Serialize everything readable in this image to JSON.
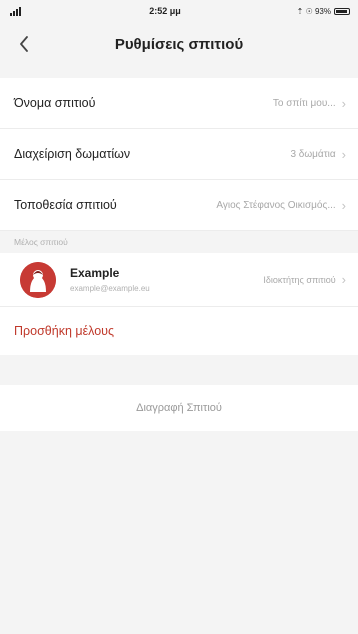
{
  "status_bar": {
    "time": "2:52 μμ",
    "battery_text": "⇡ ☉ 93%"
  },
  "nav": {
    "title": "Ρυθμίσεις σπιτιού",
    "back_icon": "chevron-left-icon"
  },
  "settings": [
    {
      "label": "Όνομα σπιτιού",
      "value": "Το σπίτι μου..."
    },
    {
      "label": "Διαχείριση δωματίων",
      "value": "3 δωμάτια"
    },
    {
      "label": "Τοποθεσία σπιτιού",
      "value": "Αγιος Στέφανος Οικισμός..."
    }
  ],
  "members_section": {
    "header": "Μέλος σπιτιού",
    "members": [
      {
        "name": "Example",
        "email": "example@example.eu",
        "role": "Ιδιοκτήτης σπιτιού",
        "avatar_color": "#c73a34"
      }
    ],
    "add_label": "Προσθήκη μέλους"
  },
  "delete_label": "Διαγραφή Σπιτιού",
  "colors": {
    "accent_red": "#c0392b",
    "background": "#f4f4f4"
  }
}
